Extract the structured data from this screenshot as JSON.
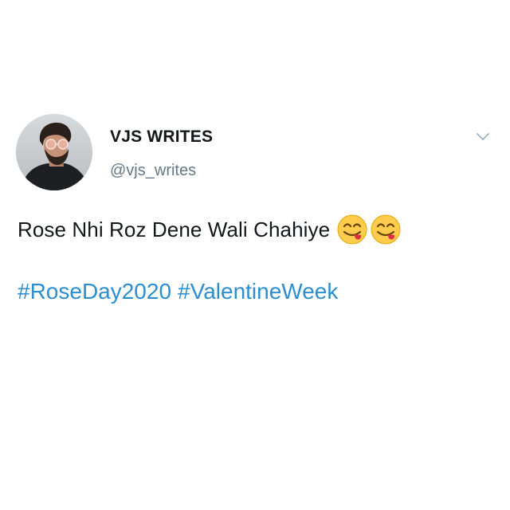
{
  "tweet": {
    "author": {
      "display_name": "VJS WRITES",
      "handle": "@vjs_writes",
      "avatar_icon": "profile-photo"
    },
    "menu_icon": "chevron-down-icon",
    "text": "Rose Nhi Roz Dene Wali Chahiye",
    "emojis": [
      "face-savoring-food",
      "face-savoring-food"
    ],
    "hashtags": [
      "#RoseDay2020",
      "#ValentineWeek"
    ]
  },
  "colors": {
    "text": "#14171a",
    "handle": "#657786",
    "link": "#2b8ed0",
    "background": "#ffffff"
  }
}
